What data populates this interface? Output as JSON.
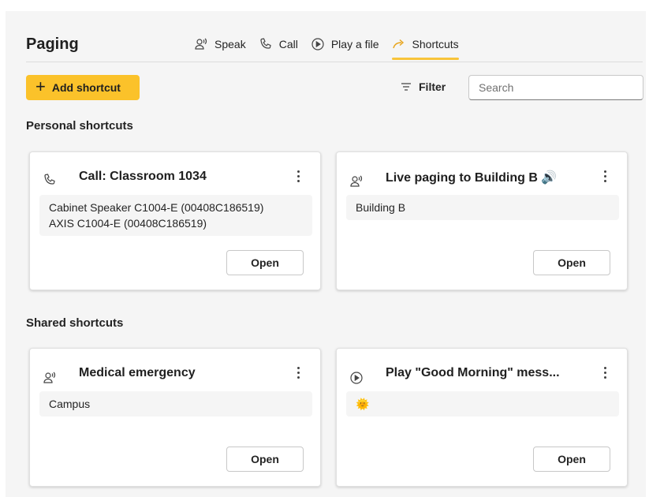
{
  "header": {
    "title": "Paging",
    "tabs": [
      {
        "label": "Speak",
        "icon": "speak-icon"
      },
      {
        "label": "Call",
        "icon": "phone-icon"
      },
      {
        "label": "Play a file",
        "icon": "play-circle-icon"
      },
      {
        "label": "Shortcuts",
        "icon": "shortcut-arrow-icon",
        "active": true
      }
    ]
  },
  "toolbar": {
    "add_label": "Add shortcut",
    "filter_label": "Filter",
    "search_placeholder": "Search"
  },
  "sections": {
    "personal": {
      "title": "Personal shortcuts",
      "cards": [
        {
          "icon": "phone-icon",
          "title": "Call: Classroom 1034",
          "lines": [
            "Cabinet Speaker C1004-E (00408C186519)",
            "AXIS C1004-E (00408C186519)"
          ],
          "open_label": "Open"
        },
        {
          "icon": "speak-icon",
          "title": "Live paging to Building B 🔊",
          "lines": [
            "Building B"
          ],
          "open_label": "Open"
        }
      ]
    },
    "shared": {
      "title": "Shared shortcuts",
      "cards": [
        {
          "icon": "speak-icon",
          "title": "Medical emergency",
          "lines": [
            "Campus"
          ],
          "open_label": "Open"
        },
        {
          "icon": "play-circle-icon",
          "title": "Play \"Good Morning\" mess...",
          "lines": [
            "🌞"
          ],
          "open_label": "Open"
        }
      ]
    }
  },
  "colors": {
    "accent": "#fbc22a",
    "tab_underline": "#f8c43a",
    "panel_bg": "#f5f5f5"
  }
}
